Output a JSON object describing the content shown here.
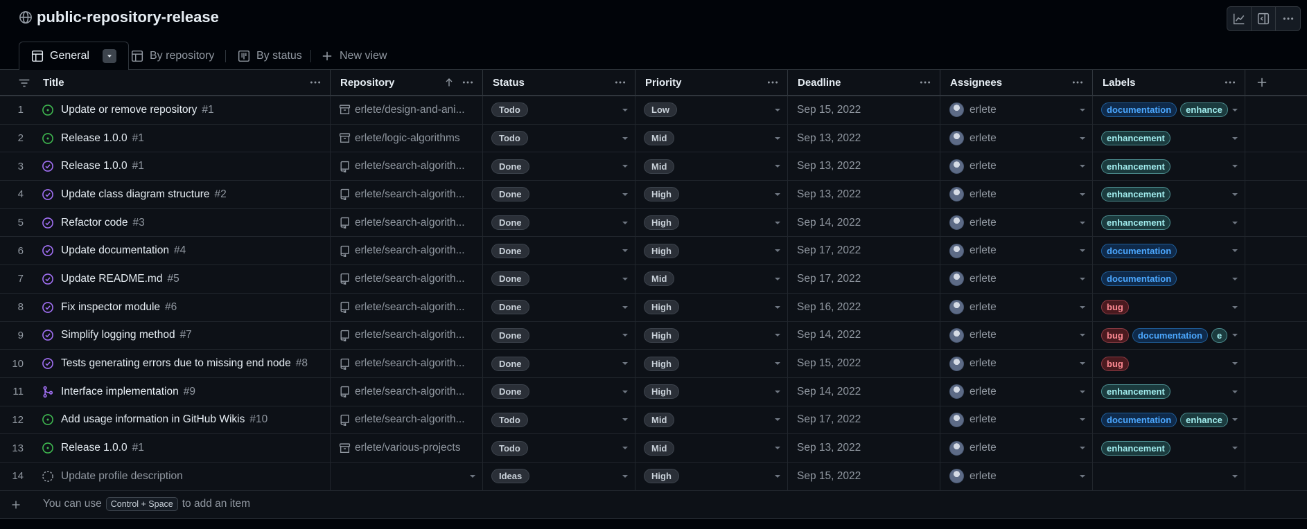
{
  "project": {
    "title": "public-repository-release",
    "icon": "globe-icon"
  },
  "top_actions": [
    {
      "name": "insights-icon"
    },
    {
      "name": "side-panel-icon"
    },
    {
      "name": "more-options-icon"
    }
  ],
  "tabs": {
    "general": "General",
    "by_repository": "By repository",
    "by_status": "By status",
    "new_view": "New view"
  },
  "columns": {
    "title": "Title",
    "repository": "Repository",
    "status": "Status",
    "priority": "Priority",
    "deadline": "Deadline",
    "assignees": "Assignees",
    "labels": "Labels"
  },
  "rows": [
    {
      "n": "1",
      "icon": "open",
      "title": "Update or remove repository",
      "num": "#1",
      "repo_icon": "archive",
      "repo": "erlete/design-and-ani...",
      "status": "Todo",
      "priority": "Low",
      "deadline": "Sep 15, 2022",
      "assignee": "erlete",
      "labels": [
        "documentation",
        "enhance"
      ]
    },
    {
      "n": "2",
      "icon": "open",
      "title": "Release 1.0.0",
      "num": "#1",
      "repo_icon": "archive",
      "repo": "erlete/logic-algorithms",
      "status": "Todo",
      "priority": "Mid",
      "deadline": "Sep 13, 2022",
      "assignee": "erlete",
      "labels": [
        "enhancement"
      ]
    },
    {
      "n": "3",
      "icon": "closed",
      "title": "Release 1.0.0",
      "num": "#1",
      "repo_icon": "repo",
      "repo": "erlete/search-algorith...",
      "status": "Done",
      "priority": "Mid",
      "deadline": "Sep 13, 2022",
      "assignee": "erlete",
      "labels": [
        "enhancement"
      ]
    },
    {
      "n": "4",
      "icon": "closed",
      "title": "Update class diagram structure",
      "num": "#2",
      "repo_icon": "repo",
      "repo": "erlete/search-algorith...",
      "status": "Done",
      "priority": "High",
      "deadline": "Sep 13, 2022",
      "assignee": "erlete",
      "labels": [
        "enhancement"
      ]
    },
    {
      "n": "5",
      "icon": "closed",
      "title": "Refactor code",
      "num": "#3",
      "repo_icon": "repo",
      "repo": "erlete/search-algorith...",
      "status": "Done",
      "priority": "High",
      "deadline": "Sep 14, 2022",
      "assignee": "erlete",
      "labels": [
        "enhancement"
      ]
    },
    {
      "n": "6",
      "icon": "closed",
      "title": "Update documentation",
      "num": "#4",
      "repo_icon": "repo",
      "repo": "erlete/search-algorith...",
      "status": "Done",
      "priority": "High",
      "deadline": "Sep 17, 2022",
      "assignee": "erlete",
      "labels": [
        "documentation"
      ]
    },
    {
      "n": "7",
      "icon": "closed",
      "title": "Update README.md",
      "num": "#5",
      "repo_icon": "repo",
      "repo": "erlete/search-algorith...",
      "status": "Done",
      "priority": "Mid",
      "deadline": "Sep 17, 2022",
      "assignee": "erlete",
      "labels": [
        "documentation"
      ]
    },
    {
      "n": "8",
      "icon": "closed",
      "title": "Fix inspector module",
      "num": "#6",
      "repo_icon": "repo",
      "repo": "erlete/search-algorith...",
      "status": "Done",
      "priority": "High",
      "deadline": "Sep 16, 2022",
      "assignee": "erlete",
      "labels": [
        "bug"
      ]
    },
    {
      "n": "9",
      "icon": "closed",
      "title": "Simplify logging method",
      "num": "#7",
      "repo_icon": "repo",
      "repo": "erlete/search-algorith...",
      "status": "Done",
      "priority": "High",
      "deadline": "Sep 14, 2022",
      "assignee": "erlete",
      "labels": [
        "bug",
        "documentation",
        "e"
      ]
    },
    {
      "n": "10",
      "icon": "closed",
      "title": "Tests generating errors due to missing end node",
      "num": "#8",
      "repo_icon": "repo",
      "repo": "erlete/search-algorith...",
      "status": "Done",
      "priority": "High",
      "deadline": "Sep 15, 2022",
      "assignee": "erlete",
      "labels": [
        "bug"
      ]
    },
    {
      "n": "11",
      "icon": "merged",
      "title": "Interface implementation",
      "num": "#9",
      "repo_icon": "repo",
      "repo": "erlete/search-algorith...",
      "status": "Done",
      "priority": "High",
      "deadline": "Sep 14, 2022",
      "assignee": "erlete",
      "labels": [
        "enhancement"
      ]
    },
    {
      "n": "12",
      "icon": "open",
      "title": "Add usage information in GitHub Wikis",
      "num": "#10",
      "repo_icon": "repo",
      "repo": "erlete/search-algorith...",
      "status": "Todo",
      "priority": "Mid",
      "deadline": "Sep 17, 2022",
      "assignee": "erlete",
      "labels": [
        "documentation",
        "enhance"
      ]
    },
    {
      "n": "13",
      "icon": "open",
      "title": "Release 1.0.0",
      "num": "#1",
      "repo_icon": "archive",
      "repo": "erlete/various-projects",
      "status": "Todo",
      "priority": "Mid",
      "deadline": "Sep 13, 2022",
      "assignee": "erlete",
      "labels": [
        "enhancement"
      ]
    },
    {
      "n": "14",
      "icon": "draft",
      "title": "Update profile description",
      "num": "",
      "repo_icon": "",
      "repo": "",
      "status": "Ideas",
      "priority": "High",
      "deadline": "Sep 15, 2022",
      "assignee": "erlete",
      "labels": []
    }
  ],
  "label_colors": {
    "documentation": "#4ca8ff",
    "enhancement": "#a2eeef",
    "bug": "#ff8a93"
  },
  "status_colors": {
    "open": "#3fb950",
    "closed": "#a371f7",
    "merged": "#a371f7",
    "draft": "#9198a1"
  },
  "footer": {
    "hint_prefix": "You can use",
    "shortcut": "Control + Space",
    "hint_suffix": "to add an item"
  }
}
